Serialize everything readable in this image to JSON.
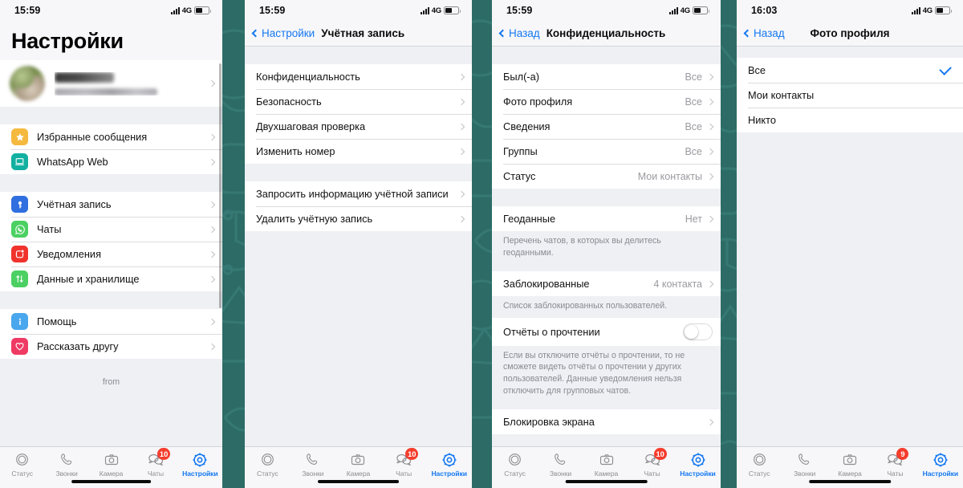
{
  "theme": {
    "background_teal": "#2d6b66",
    "doodle_stroke": "#3f8680",
    "accent_blue": "#1478f0",
    "badge_red": "#f53d2d",
    "panel_grey": "#eef0f4"
  },
  "tabbar": {
    "items": [
      {
        "label": "Статус",
        "icon": "status-rings-icon",
        "active": false,
        "badge": null
      },
      {
        "label": "Звонки",
        "icon": "phone-icon",
        "active": false,
        "badge": null
      },
      {
        "label": "Камера",
        "icon": "camera-icon",
        "active": false,
        "badge": null
      },
      {
        "label": "Чаты",
        "icon": "chats-bubbles-icon",
        "active": false,
        "badge": "10"
      },
      {
        "label": "Настройки",
        "icon": "gear-icon",
        "active": true,
        "badge": null
      }
    ],
    "badge_panel4": "9"
  },
  "panel1": {
    "status": {
      "time": "15:59",
      "network": "4G"
    },
    "title": "Настройки",
    "profile": {
      "name": "",
      "status": "",
      "blurred": true
    },
    "group_a": [
      {
        "label": "Избранные сообщения",
        "icon": "star-icon",
        "color": "#f5b93f"
      },
      {
        "label": "WhatsApp Web",
        "icon": "laptop-icon",
        "color": "#12b0a0"
      }
    ],
    "group_b": [
      {
        "label": "Учётная запись",
        "icon": "key-icon",
        "color": "#2f6fe0"
      },
      {
        "label": "Чаты",
        "icon": "whatsapp-icon",
        "color": "#4cd063"
      },
      {
        "label": "Уведомления",
        "icon": "bell-dot-icon",
        "color": "#f0332c"
      },
      {
        "label": "Данные и хранилище",
        "icon": "arrows-icon",
        "color": "#4cd063"
      }
    ],
    "group_c": [
      {
        "label": "Помощь",
        "icon": "info-icon",
        "color": "#49a7ed"
      },
      {
        "label": "Рассказать другу",
        "icon": "heart-icon",
        "color": "#ef3a63"
      }
    ],
    "footer_text": "from"
  },
  "panel2": {
    "status": {
      "time": "15:59",
      "network": "4G"
    },
    "nav": {
      "back_label": "Настройки",
      "title": "Учётная запись"
    },
    "group_a": [
      {
        "label": "Конфиденциальность"
      },
      {
        "label": "Безопасность"
      },
      {
        "label": "Двухшаговая проверка"
      },
      {
        "label": "Изменить номер"
      }
    ],
    "group_b": [
      {
        "label": "Запросить информацию учётной записи"
      },
      {
        "label": "Удалить учётную запись"
      }
    ]
  },
  "panel3": {
    "status": {
      "time": "15:59",
      "network": "4G"
    },
    "nav": {
      "back_label": "Назад",
      "title": "Конфиденциальность"
    },
    "group_a": [
      {
        "label": "Был(-а)",
        "value": "Все"
      },
      {
        "label": "Фото профиля",
        "value": "Все"
      },
      {
        "label": "Сведения",
        "value": "Все"
      },
      {
        "label": "Группы",
        "value": "Все"
      },
      {
        "label": "Статус",
        "value": "Мои контакты"
      }
    ],
    "geo": {
      "label": "Геоданные",
      "value": "Нет"
    },
    "geo_footnote": "Перечень чатов, в которых вы делитесь геоданными.",
    "blocked": {
      "label": "Заблокированные",
      "value": "4 контакта"
    },
    "blocked_footnote": "Список заблокированных пользователей.",
    "read_receipts": {
      "label": "Отчёты о прочтении",
      "on": false
    },
    "read_receipts_footnote": "Если вы отключите отчёты о прочтении, то не сможете видеть отчёты о прочтении у других пользователей. Данные уведомления нельзя отключить для групповых чатов.",
    "screen_lock": {
      "label": "Блокировка экрана"
    }
  },
  "panel4": {
    "status": {
      "time": "16:03",
      "network": "4G"
    },
    "nav": {
      "back_label": "Назад",
      "title": "Фото профиля"
    },
    "options": [
      {
        "label": "Все",
        "selected": true
      },
      {
        "label": "Мои контакты",
        "selected": false
      },
      {
        "label": "Никто",
        "selected": false
      }
    ]
  }
}
